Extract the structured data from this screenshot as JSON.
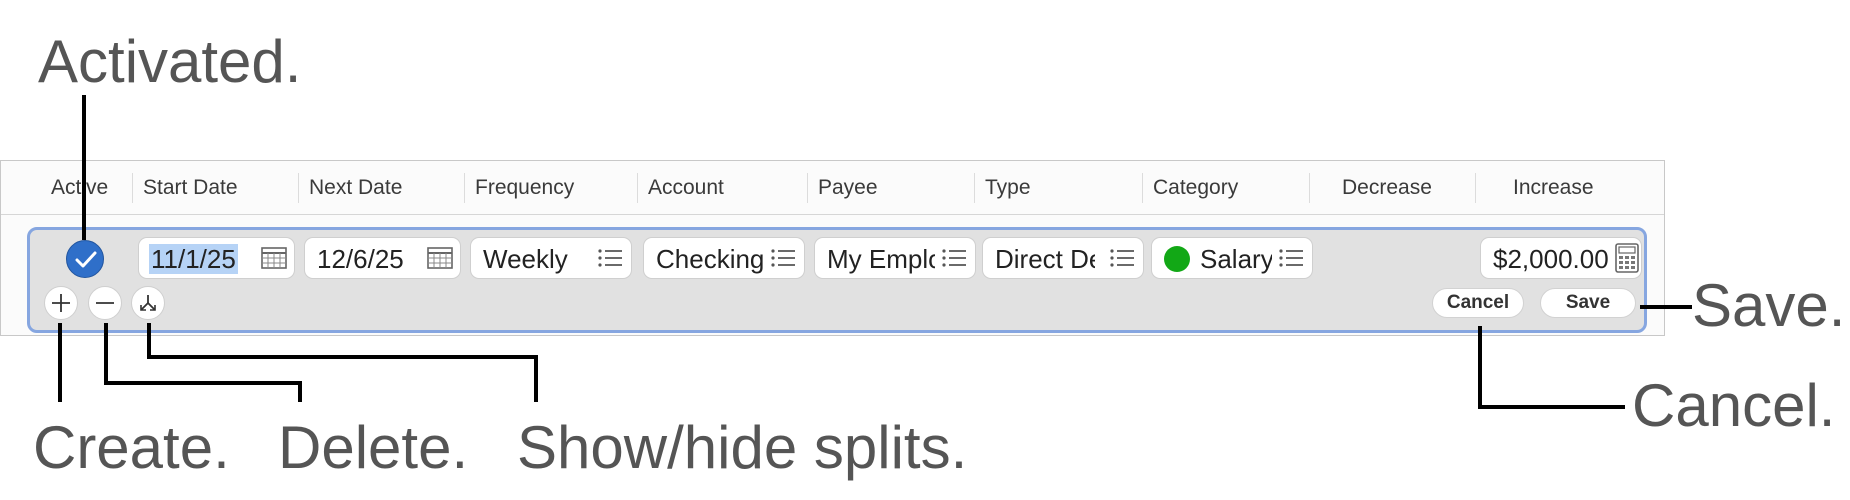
{
  "callouts": {
    "activated": "Activated.",
    "create": "Create.",
    "delete": "Delete.",
    "splits": "Show/hide splits.",
    "save": "Save.",
    "cancel": "Cancel."
  },
  "columns": [
    "Active",
    "Start Date",
    "Next Date",
    "Frequency",
    "Account",
    "Payee",
    "Type",
    "Category",
    "Decrease",
    "Increase"
  ],
  "row": {
    "active": true,
    "start_date": "11/1/25",
    "next_date": "12/6/25",
    "frequency": "Weekly",
    "account": "Checking",
    "payee": "My Employer",
    "type": "Direct Deposit",
    "category": "Salary",
    "category_color": "#12a816",
    "increase": "$2,000.00"
  },
  "buttons": {
    "cancel": "Cancel",
    "save": "Save"
  },
  "icons": {
    "date": "calendar-icon",
    "list": "list-icon",
    "amount": "calculator-icon"
  },
  "colors": {
    "selection_border": "#86a6e0",
    "check": "#2f6fc9",
    "callout_text": "#555555"
  }
}
